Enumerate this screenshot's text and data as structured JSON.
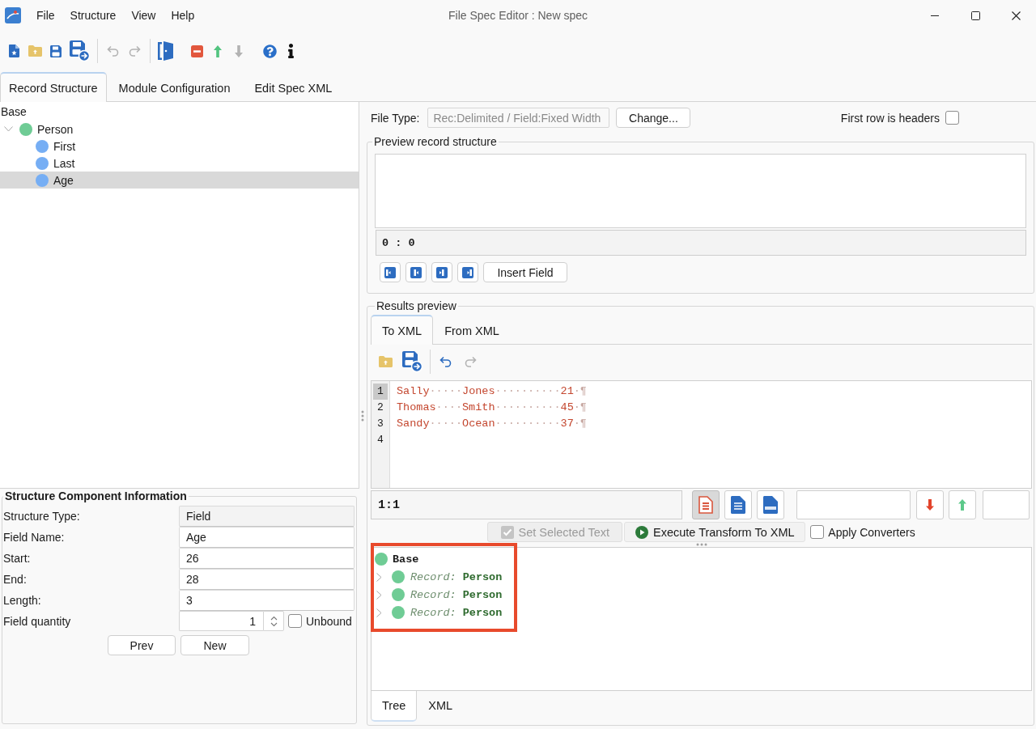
{
  "window": {
    "title": "File Spec Editor : New spec"
  },
  "menu": [
    "File",
    "Structure",
    "View",
    "Help"
  ],
  "toolbar": [
    {
      "divider": true,
      "items": [
        {
          "kind": "new",
          "disabled": false
        },
        {
          "kind": "open",
          "disabled": false
        },
        {
          "kind": "save",
          "disabled": false
        },
        {
          "kind": "save_as",
          "disabled": false
        }
      ]
    },
    {
      "divider": true,
      "items": [
        {
          "kind": "undo",
          "disabled": true
        },
        {
          "kind": "redo",
          "disabled": true
        }
      ]
    },
    {
      "divider": false,
      "items": [
        {
          "kind": "exit",
          "disabled": false
        }
      ]
    },
    {
      "divider": false,
      "items": [
        {
          "kind": "delete",
          "disabled": false
        },
        {
          "kind": "move_up",
          "disabled": false
        },
        {
          "kind": "move_down",
          "disabled": true
        }
      ]
    },
    {
      "divider": false,
      "items": [
        {
          "kind": "help",
          "disabled": false
        },
        {
          "kind": "info",
          "disabled": false
        }
      ]
    }
  ],
  "tabs": [
    {
      "label": "Record Structure",
      "selected": true
    },
    {
      "label": "Module Configuration",
      "selected": false
    },
    {
      "label": "Edit Spec XML",
      "selected": false
    }
  ],
  "structure_tree": {
    "root": "Base",
    "items": [
      {
        "label": "Person",
        "kind": "record",
        "expanded": true,
        "selected": false,
        "children": [
          {
            "label": "First",
            "kind": "field",
            "selected": false
          },
          {
            "label": "Last",
            "kind": "field",
            "selected": false
          },
          {
            "label": "Age",
            "kind": "field",
            "selected": true
          }
        ]
      }
    ]
  },
  "component_info": {
    "title": "Structure Component Information",
    "fields": [
      {
        "label": "Structure Type:",
        "value": "Field",
        "readonly": true
      },
      {
        "label": "Field Name:",
        "value": "Age",
        "readonly": false
      },
      {
        "label": "Start:",
        "value": "26",
        "readonly": false
      },
      {
        "label": "End:",
        "value": "28",
        "readonly": false
      },
      {
        "label": "Length:",
        "value": "3",
        "readonly": false
      }
    ],
    "quantity": {
      "label": "Field quantity",
      "value": "1"
    },
    "unbound": {
      "label": "Unbound",
      "checked": false
    },
    "buttons": [
      "Prev",
      "New"
    ]
  },
  "file_type": {
    "label": "File Type:",
    "value": "Rec:Delimited / Field:Fixed Width",
    "disabled": true,
    "button": "Change...",
    "headers": {
      "label": "First row is headers",
      "checked": false
    }
  },
  "preview_structure": {
    "title": "Preview record structure",
    "position": "0 : 0",
    "tools": [
      {
        "kind": "first"
      },
      {
        "kind": "previous"
      },
      {
        "kind": "next"
      },
      {
        "kind": "last"
      }
    ],
    "insert_button": "Insert Field"
  },
  "results_preview": {
    "title": "Results preview",
    "tabs": [
      {
        "label": "To XML",
        "selected": true
      },
      {
        "label": "From XML",
        "selected": false
      }
    ],
    "toolbar": [
      {
        "divider": true,
        "items": [
          {
            "kind": "open",
            "disabled": false
          },
          {
            "kind": "save_as",
            "disabled": false
          }
        ]
      },
      {
        "divider": false,
        "items": [
          {
            "kind": "undo",
            "disabled": false
          },
          {
            "kind": "redo",
            "disabled": true
          }
        ]
      }
    ],
    "editor": {
      "lines": [
        {
          "number": "1",
          "current": true,
          "segments": [
            {
              "kind": "text",
              "text": "Sally"
            },
            {
              "kind": "mark",
              "text": "·····"
            },
            {
              "kind": "text",
              "text": "Jones"
            },
            {
              "kind": "mark",
              "text": "··········"
            },
            {
              "kind": "text",
              "text": "21"
            },
            {
              "kind": "mark",
              "text": "·¶"
            }
          ]
        },
        {
          "number": "2",
          "current": false,
          "segments": [
            {
              "kind": "text",
              "text": "Thomas"
            },
            {
              "kind": "mark",
              "text": "····"
            },
            {
              "kind": "text",
              "text": "Smith"
            },
            {
              "kind": "mark",
              "text": "··········"
            },
            {
              "kind": "text",
              "text": "45"
            },
            {
              "kind": "mark",
              "text": "·¶"
            }
          ]
        },
        {
          "number": "3",
          "current": false,
          "segments": [
            {
              "kind": "text",
              "text": "Sandy"
            },
            {
              "kind": "mark",
              "text": "·····"
            },
            {
              "kind": "text",
              "text": "Ocean"
            },
            {
              "kind": "mark",
              "text": "··········"
            },
            {
              "kind": "text",
              "text": "37"
            },
            {
              "kind": "mark",
              "text": "·¶"
            }
          ]
        },
        {
          "number": "4",
          "current": false
        }
      ]
    },
    "cursor": "1:1",
    "view_modes": [
      {
        "kind": "text",
        "selected": true
      },
      {
        "kind": "document",
        "selected": false
      },
      {
        "kind": "html",
        "selected": false
      }
    ],
    "navigation": [
      {
        "kind": "down"
      },
      {
        "kind": "up"
      }
    ],
    "actions": [
      {
        "kind": "set_selection",
        "label": "Set Selected Text",
        "disabled": true
      },
      {
        "kind": "execute",
        "label": "Execute Transform To XML",
        "disabled": false
      }
    ],
    "apply_converters": {
      "label": "Apply Converters",
      "checked": false
    },
    "output_tree": {
      "root": "Base",
      "highlighted": true,
      "items": [
        {
          "type": "Record:",
          "name": "Person",
          "expanded": false
        },
        {
          "type": "Record:",
          "name": "Person",
          "expanded": false
        },
        {
          "type": "Record:",
          "name": "Person",
          "expanded": false
        }
      ]
    },
    "output_tabs": [
      {
        "label": "Tree",
        "selected": true
      },
      {
        "label": "XML",
        "selected": false
      }
    ]
  }
}
